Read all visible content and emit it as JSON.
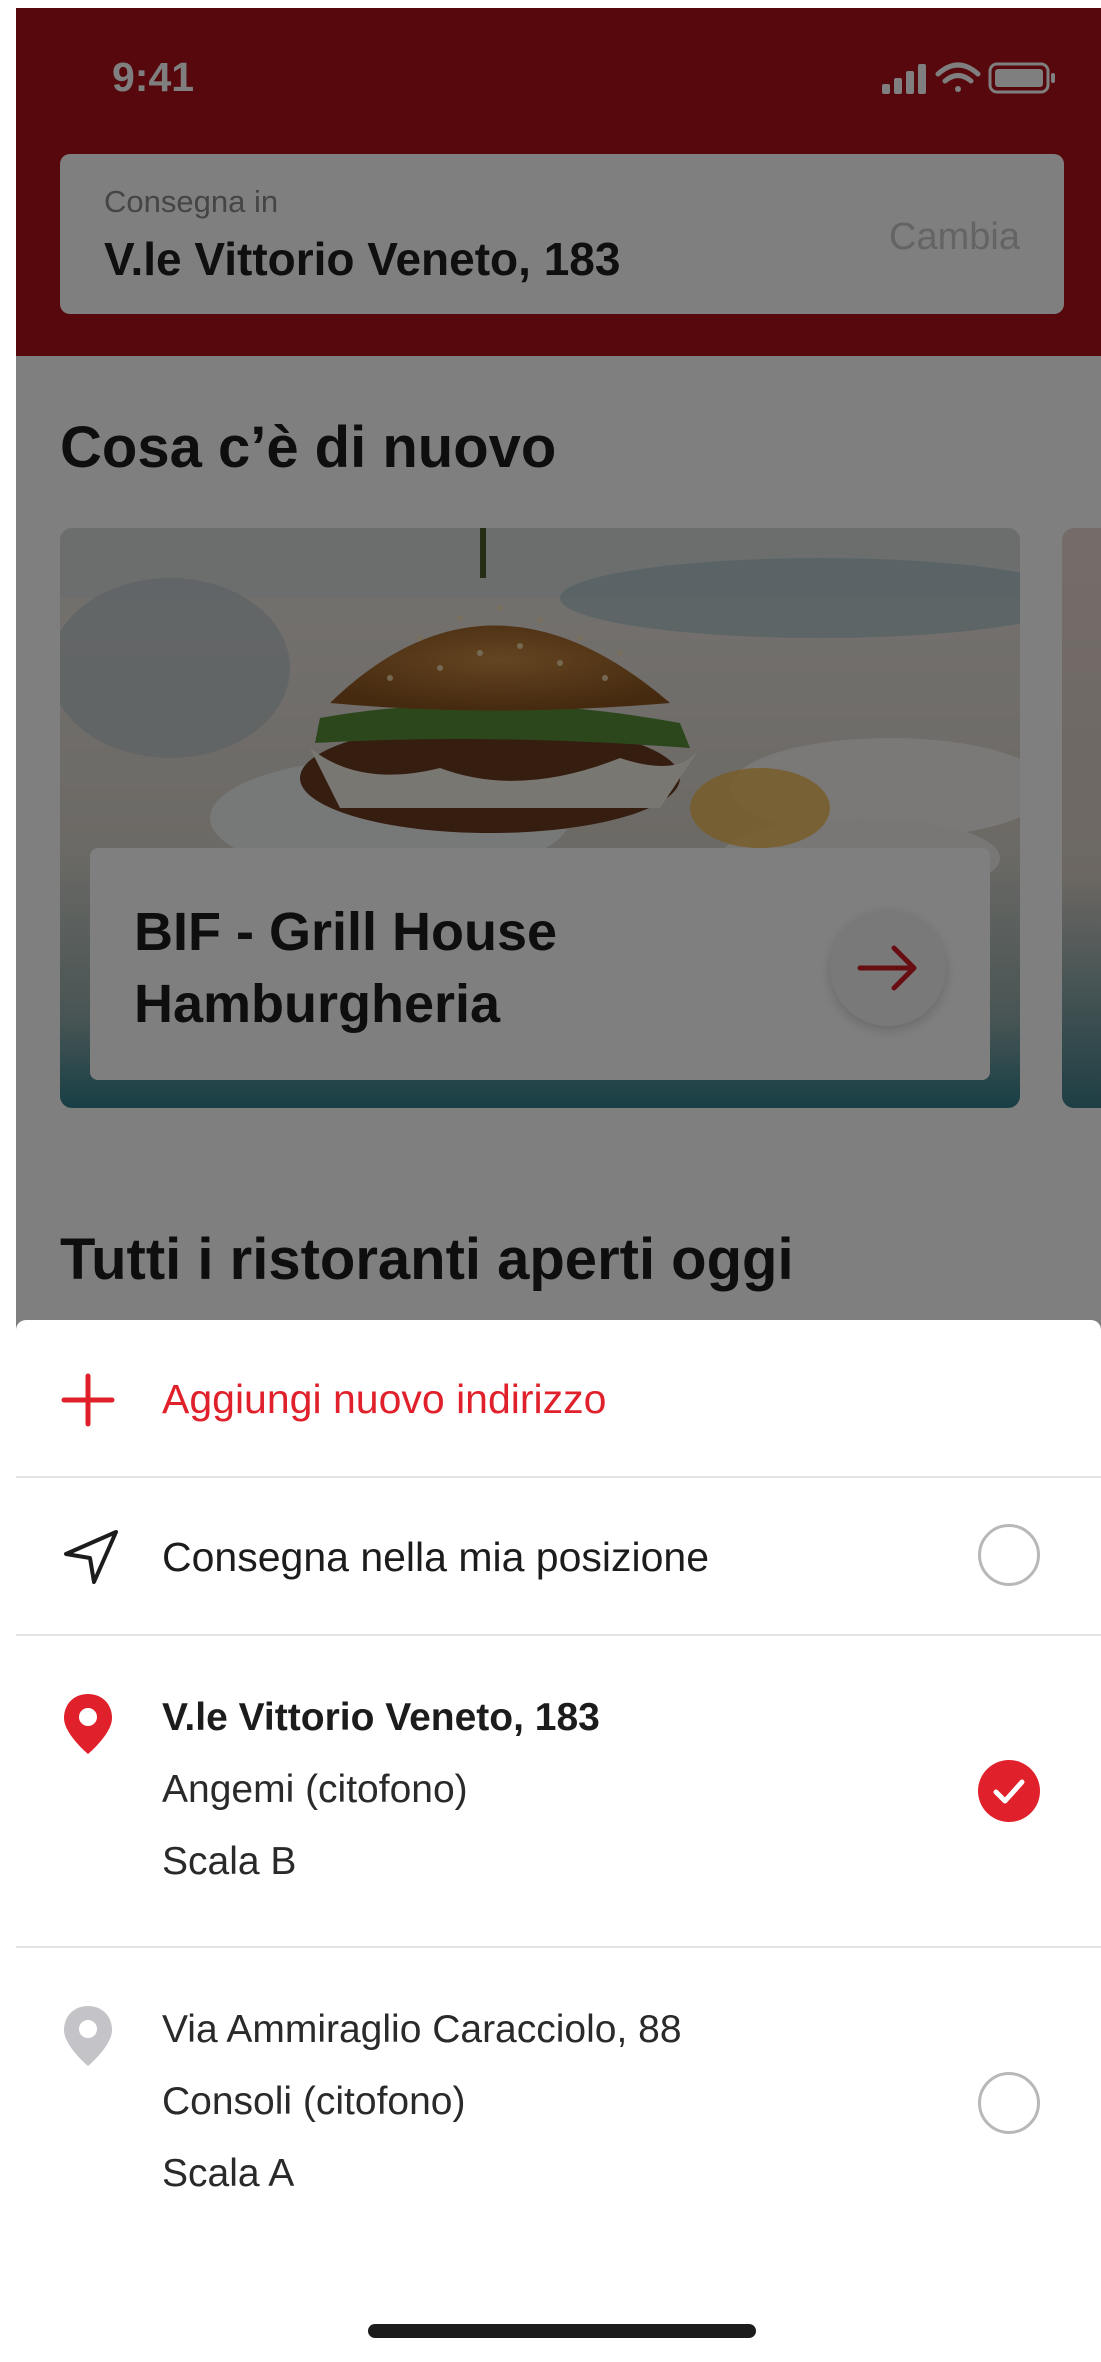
{
  "status_bar": {
    "time": "9:41",
    "icons": [
      "signal-icon",
      "wifi-icon",
      "battery-icon"
    ]
  },
  "header": {
    "delivery_caption": "Consegna in",
    "delivery_address": "V.le Vittorio Veneto, 183",
    "change_label": "Cambia"
  },
  "news": {
    "title": "Cosa c’è di nuovo",
    "card_title": "BIF - Grill House Hamburgheria"
  },
  "all_restaurants": {
    "title": "Tutti i ristoranti aperti oggi"
  },
  "sheet": {
    "add_address_label": "Aggiungi nuovo indirizzo",
    "current_location_label": "Consegna nella mia posizione",
    "addresses": [
      {
        "street": "V.le Vittorio Veneto, 183",
        "intercom": "Angemi (citofono)",
        "stair": "Scala B",
        "selected": true
      },
      {
        "street": "Via Ammiraglio Caracciolo, 88",
        "intercom": "Consoli (citofono)",
        "stair": "Scala A",
        "selected": false
      }
    ]
  },
  "colors": {
    "brand_red": "#ad1119",
    "accent_red": "#e0202a"
  }
}
